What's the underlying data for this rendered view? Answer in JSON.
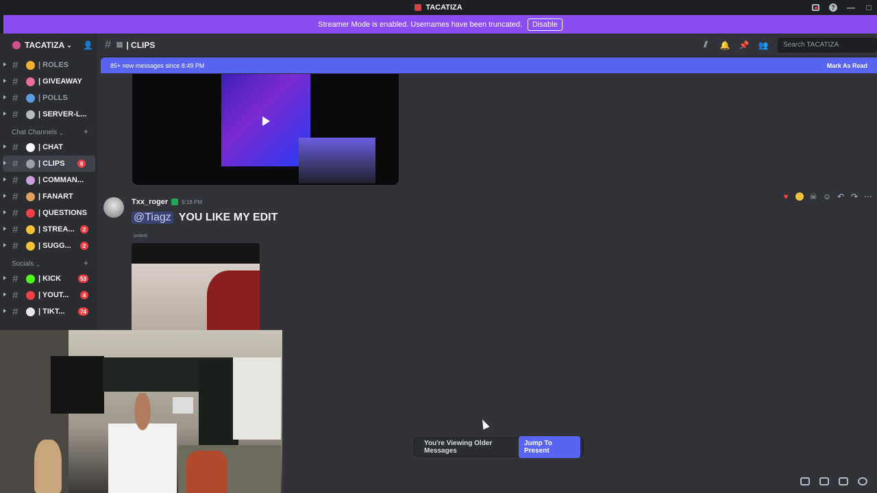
{
  "window": {
    "title": "TACATIZA"
  },
  "banner": {
    "text": "Streamer Mode is enabled. Usernames have been truncated.",
    "button": "Disable"
  },
  "server": {
    "name": "TACATIZA"
  },
  "sidebar": {
    "channels_top": [
      {
        "label": "| ROLES",
        "icon": "folder-emoji",
        "color": "#f0b232",
        "muted": true
      },
      {
        "label": "| GIVEAWAY",
        "icon": "party-emoji",
        "color": "#e86f9a",
        "muted": false
      },
      {
        "label": "| POLLS",
        "icon": "chart-emoji",
        "color": "#5d9ae0",
        "muted": true
      },
      {
        "label": "| SERVER-L...",
        "icon": "link-emoji",
        "color": "#b5bac1",
        "muted": false
      }
    ],
    "chat_category": "Chat Channels",
    "chat_channels": [
      {
        "label": "| CHAT",
        "icon": "speech-emoji",
        "color": "#ffffff",
        "badge": ""
      },
      {
        "label": "| CLIPS",
        "icon": "clapper-emoji",
        "color": "#9aa0a6",
        "badge": "8"
      },
      {
        "label": "| COMMAN...",
        "icon": "robot-emoji",
        "color": "#c9a0dc",
        "badge": ""
      },
      {
        "label": "| FANART",
        "icon": "palette-emoji",
        "color": "#e0a060",
        "badge": ""
      },
      {
        "label": "| QUESTIONS",
        "icon": "question-emoji",
        "color": "#ed4245",
        "badge": ""
      },
      {
        "label": "| STREA...",
        "icon": "bulb-emoji",
        "color": "#f5c33b",
        "badge": "2"
      },
      {
        "label": "| SUGG...",
        "icon": "thinking-emoji",
        "color": "#f5c33b",
        "badge": "2"
      }
    ],
    "socials_category": "Socials",
    "social_channels": [
      {
        "label": "| KICK",
        "icon": "kick-emoji",
        "color": "#53fc18",
        "badge": "53"
      },
      {
        "label": "| YOUT...",
        "icon": "youtube-emoji",
        "color": "#ed4245",
        "badge": "4"
      },
      {
        "label": "| TIKT...",
        "icon": "tiktok-emoji",
        "color": "#e6e6e6",
        "badge": "74"
      }
    ]
  },
  "header": {
    "channel": "| CLIPS",
    "search_placeholder": "Search TACATIZA"
  },
  "newbar": {
    "text": "85+ new messages since 8:49 PM",
    "action": "Mark As Read"
  },
  "message": {
    "author": "Txx_roger",
    "time": "9:18 PM",
    "mention": "@Tiagz",
    "text": "YOU LIKE MY EDIT",
    "edited": "(edited)"
  },
  "older_bar": {
    "text": "You're Viewing Older Messages",
    "button": "Jump To Present"
  },
  "colors": {
    "accent": "#5865f2",
    "banner": "#8c4df5",
    "badge": "#f23f43"
  }
}
